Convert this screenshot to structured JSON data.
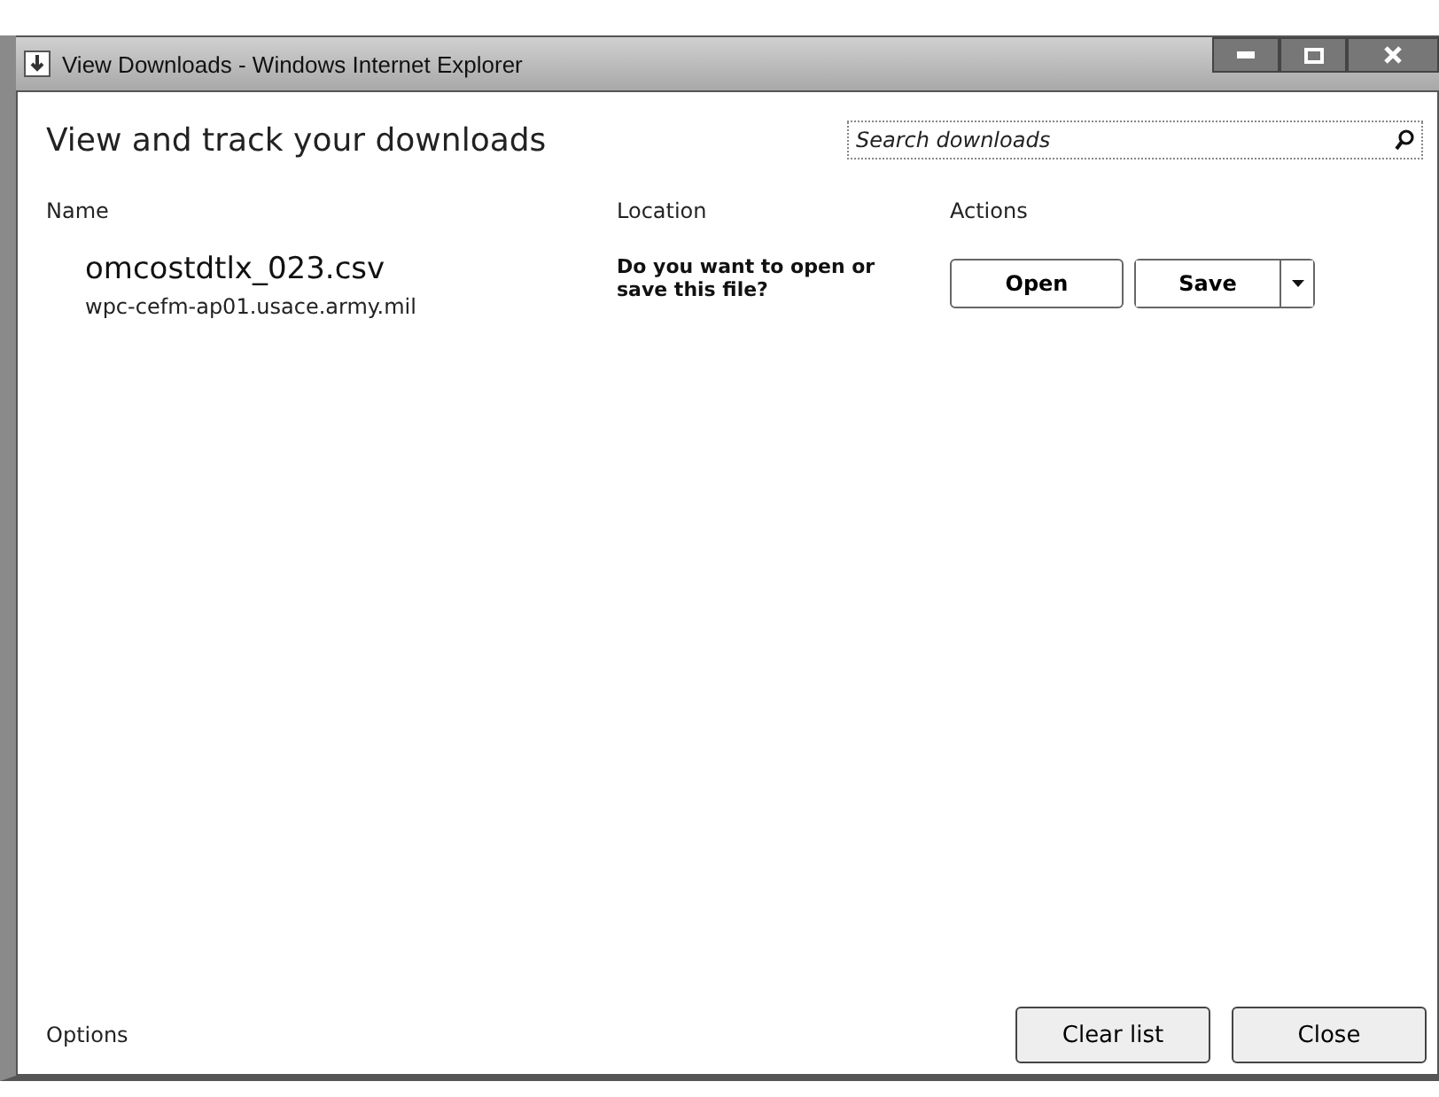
{
  "window": {
    "title": "View Downloads - Windows Internet Explorer"
  },
  "header": {
    "heading": "View and track your downloads",
    "search": {
      "placeholder": "Search downloads"
    }
  },
  "columns": [
    "Name",
    "Location",
    "Actions"
  ],
  "downloads": [
    {
      "file": "omcostdtlx_023.csv",
      "source": "wpc-cefm-ap01.usace.army.mil",
      "prompt": "Do you want to open or save this file?",
      "actions": [
        {
          "kind": "button",
          "label": "Open"
        },
        {
          "kind": "split",
          "label": "Save"
        }
      ]
    }
  ],
  "footer": {
    "link": "Options",
    "buttons": [
      "Clear list",
      "Close"
    ]
  }
}
